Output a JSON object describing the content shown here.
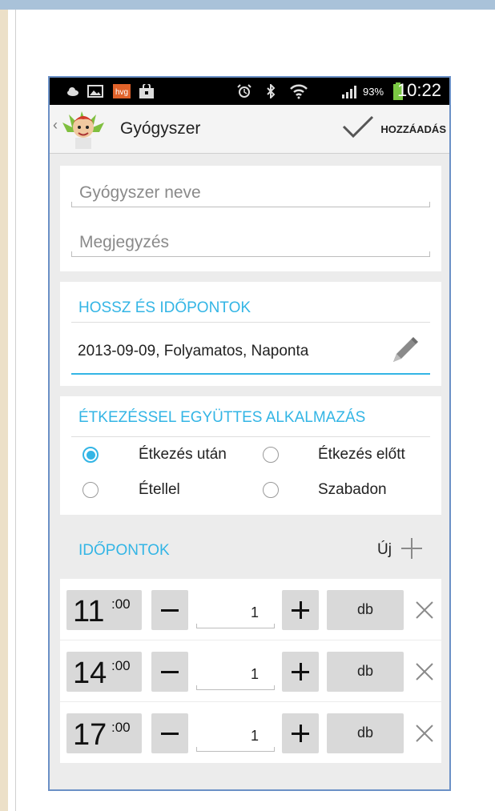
{
  "app": {
    "title": "Gyógyszer",
    "add_label": "HOZZÁADÁS"
  },
  "statusbar": {
    "time": "10:22",
    "battery_percent": "93%",
    "icons": [
      "cloud-icon",
      "image-icon",
      "hvg-app-icon",
      "shopping-bag-icon",
      "alarm-icon",
      "bluetooth-icon",
      "wifi-icon",
      "signal-icon",
      "battery-icon"
    ],
    "hvg_icon_text": "hvg"
  },
  "form": {
    "name_placeholder": "Gyógyszer neve",
    "note_placeholder": "Megjegyzés"
  },
  "schedule": {
    "header": "HOSSZ ÉS IDŐPONTOK",
    "value": "2013-09-09, Folyamatos, Naponta"
  },
  "meals": {
    "header": "ÉTKEZÉSSEL EGYÜTTES ALKALMAZÁS",
    "options": [
      {
        "label": "Étkezés után",
        "selected": true
      },
      {
        "label": "Étkezés előtt",
        "selected": false
      },
      {
        "label": "Étellel",
        "selected": false
      },
      {
        "label": "Szabadon",
        "selected": false
      }
    ]
  },
  "times": {
    "header": "IDŐPONTOK",
    "new_label": "Új",
    "rows": [
      {
        "hour": "11",
        "minute": ":00",
        "qty": "1",
        "unit": "db"
      },
      {
        "hour": "14",
        "minute": ":00",
        "qty": "1",
        "unit": "db"
      },
      {
        "hour": "17",
        "minute": ":00",
        "qty": "1",
        "unit": "db"
      }
    ]
  },
  "colors": {
    "accent": "#33b5e5",
    "frame_border": "#6b90c6",
    "statusbar_bg": "#000000",
    "background": "#ececec",
    "battery": "#7ac943"
  }
}
